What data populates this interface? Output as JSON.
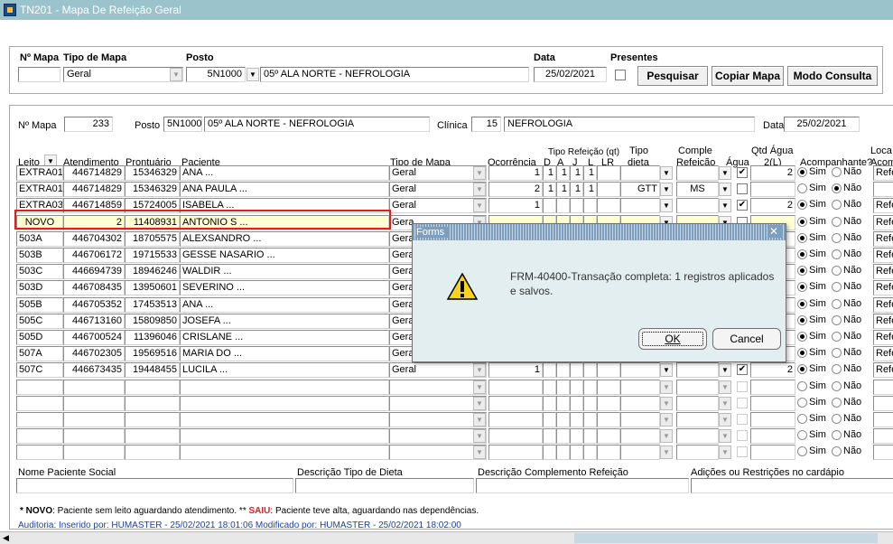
{
  "window": {
    "title": "TN201 - Mapa De Refeição Geral"
  },
  "search": {
    "labels": {
      "n_mapa": "Nº Mapa",
      "tipo_mapa": "Tipo de Mapa",
      "posto": "Posto",
      "data": "Data",
      "presentes": "Presentes"
    },
    "n_mapa": "",
    "tipo_mapa": "Geral",
    "posto_code": "5N1000",
    "posto_name": "05º ALA NORTE - NEFROLOGIA",
    "data": "25/02/2021",
    "buttons": {
      "pesquisar": "Pesquisar",
      "copiar": "Copiar Mapa",
      "modo": "Modo Consulta"
    }
  },
  "header": {
    "labels": {
      "n_mapa": "Nº Mapa",
      "posto": "Posto",
      "clinica": "Clínica",
      "data": "Data"
    },
    "n_mapa": "233",
    "posto_code": "5N1000",
    "posto_name": "05º ALA NORTE - NEFROLOGIA",
    "clinica_code": "15",
    "clinica_name": "NEFROLOGIA",
    "data": "25/02/2021"
  },
  "columns": {
    "leito": "Leito",
    "atendimento": "Atendimento",
    "prontuario": "Prontuário",
    "paciente": "Paciente",
    "tipo_mapa": "Tipo de Mapa",
    "ocorrencia": "Ocorrência",
    "tipo_refeicao": "Tipo Refeição (qt)",
    "d": "D",
    "a": "A",
    "j": "J",
    "l": "L",
    "lr": "LR",
    "tipo_dieta_1": "Tipo",
    "tipo_dieta_2": "dieta",
    "comple_1": "Comple",
    "comple_2": "Refeição",
    "agua": "Água",
    "qtd_1": "Qtd Água",
    "qtd_2": "2(L)",
    "acomp": "Acompanhante?",
    "loca_1": "Loca",
    "loca_2": "Acom"
  },
  "rows": [
    {
      "leito": "EXTRA01",
      "atend": "446714829",
      "pront": "15346329",
      "pac": "ANA ...",
      "tipo": "Geral",
      "oc": "1",
      "d": "1",
      "a": "1",
      "j": "1",
      "l": "1",
      "lr": "",
      "dieta": "",
      "comp": "",
      "agua": "✔",
      "qtd": "2",
      "sim": true,
      "loca": "Refe"
    },
    {
      "leito": "EXTRA01",
      "atend": "446714829",
      "pront": "15346329",
      "pac": "ANA PAULA ...",
      "tipo": "Geral",
      "oc": "2",
      "d": "1",
      "a": "1",
      "j": "1",
      "l": "1",
      "lr": "",
      "dieta": "GTT",
      "comp": "MS",
      "agua": "",
      "qtd": "",
      "sim": false,
      "loca": ""
    },
    {
      "leito": "EXTRA03",
      "atend": "446714859",
      "pront": "15724005",
      "pac": "ISABELA ...",
      "tipo": "Geral",
      "oc": "1",
      "d": "",
      "a": "",
      "j": "",
      "l": "",
      "lr": "",
      "dieta": "",
      "comp": "",
      "agua": "✔",
      "qtd": "2",
      "sim": true,
      "loca": "Refe"
    },
    {
      "leito": "NOVO",
      "atend": "2",
      "pront": "11408931",
      "pac": "ANTONIO S ...",
      "tipo": "Gera",
      "oc": "",
      "d": "",
      "a": "",
      "j": "",
      "l": "",
      "lr": "",
      "dieta": "",
      "comp": "",
      "agua": "",
      "qtd": "",
      "sim": true,
      "loca": "Refe"
    },
    {
      "leito": "503A",
      "atend": "446704302",
      "pront": "18705575",
      "pac": "ALEXSANDRO ...",
      "tipo": "Gera",
      "oc": "",
      "d": "",
      "a": "",
      "j": "",
      "l": "",
      "lr": "",
      "dieta": "",
      "comp": "",
      "agua": "",
      "qtd": "",
      "sim": true,
      "loca": "Refe"
    },
    {
      "leito": "503B",
      "atend": "446706172",
      "pront": "19715533",
      "pac": "GESSE NASARIO ...",
      "tipo": "Gera",
      "oc": "",
      "d": "",
      "a": "",
      "j": "",
      "l": "",
      "lr": "",
      "dieta": "",
      "comp": "",
      "agua": "",
      "qtd": "",
      "sim": true,
      "loca": "Refe"
    },
    {
      "leito": "503C",
      "atend": "446694739",
      "pront": "18946246",
      "pac": "WALDIR ...",
      "tipo": "Gera",
      "oc": "",
      "d": "",
      "a": "",
      "j": "",
      "l": "",
      "lr": "",
      "dieta": "",
      "comp": "",
      "agua": "",
      "qtd": "",
      "sim": true,
      "loca": "Refe"
    },
    {
      "leito": "503D",
      "atend": "446708435",
      "pront": "13950601",
      "pac": "SEVERINO ...",
      "tipo": "Gera",
      "oc": "",
      "d": "",
      "a": "",
      "j": "",
      "l": "",
      "lr": "",
      "dieta": "",
      "comp": "",
      "agua": "",
      "qtd": "",
      "sim": true,
      "loca": "Refe"
    },
    {
      "leito": "505B",
      "atend": "446705352",
      "pront": "17453513",
      "pac": "ANA ...",
      "tipo": "Gera",
      "oc": "",
      "d": "",
      "a": "",
      "j": "",
      "l": "",
      "lr": "",
      "dieta": "",
      "comp": "",
      "agua": "",
      "qtd": "",
      "sim": true,
      "loca": "Refe"
    },
    {
      "leito": "505C",
      "atend": "446713160",
      "pront": "15809850",
      "pac": "JOSEFA ...",
      "tipo": "Gera",
      "oc": "",
      "d": "",
      "a": "",
      "j": "",
      "l": "",
      "lr": "",
      "dieta": "",
      "comp": "",
      "agua": "",
      "qtd": "",
      "sim": true,
      "loca": "Refe"
    },
    {
      "leito": "505D",
      "atend": "446700524",
      "pront": "11396046",
      "pac": "CRISLANE ...",
      "tipo": "Gera",
      "oc": "",
      "d": "",
      "a": "",
      "j": "",
      "l": "",
      "lr": "",
      "dieta": "",
      "comp": "",
      "agua": "",
      "qtd": "",
      "sim": true,
      "loca": "Refe"
    },
    {
      "leito": "507A",
      "atend": "446702305",
      "pront": "19569516",
      "pac": "MARIA DO ...",
      "tipo": "Gera",
      "oc": "",
      "d": "",
      "a": "",
      "j": "",
      "l": "",
      "lr": "",
      "dieta": "",
      "comp": "",
      "agua": "",
      "qtd": "",
      "sim": true,
      "loca": "Refe"
    },
    {
      "leito": "507C",
      "atend": "446673435",
      "pront": "19448455",
      "pac": "LUCILA ...",
      "tipo": "Geral",
      "oc": "1",
      "d": "",
      "a": "",
      "j": "",
      "l": "",
      "lr": "",
      "dieta": "",
      "comp": "",
      "agua": "✔",
      "qtd": "2",
      "sim": true,
      "loca": "Refe"
    }
  ],
  "radio": {
    "sim": "Sim",
    "nao": "Não"
  },
  "bottom": {
    "nome_social": "Nome Paciente Social",
    "desc_dieta": "Descrição Tipo de Dieta",
    "desc_comp": "Descrição Complemento Refeição",
    "adicoes": "Adições ou Restrições no cardápio"
  },
  "legend": {
    "novo_key": "* NOVO",
    "novo_text": ": Paciente sem leito aguardando atendimento. ** ",
    "saiu_key": "SAIU",
    "saiu_text": ": Paciente teve alta, aguardando nas dependências."
  },
  "audit": "Auditoria: Inserido por: HUMASTER - 25/02/2021 18:01:06   Modificado por: HUMASTER - 25/02/2021 18:02:00",
  "dialog": {
    "title": "Forms",
    "message": "FRM-40400-Transação completa: 1 registros aplicados e salvos.",
    "ok": "OK",
    "cancel": "Cancel"
  },
  "colors": {
    "titlebar": "#9bc3cb",
    "highlight": "#e02020",
    "selected_row": "#ffffd2",
    "audit_text": "#1a3fa8"
  }
}
